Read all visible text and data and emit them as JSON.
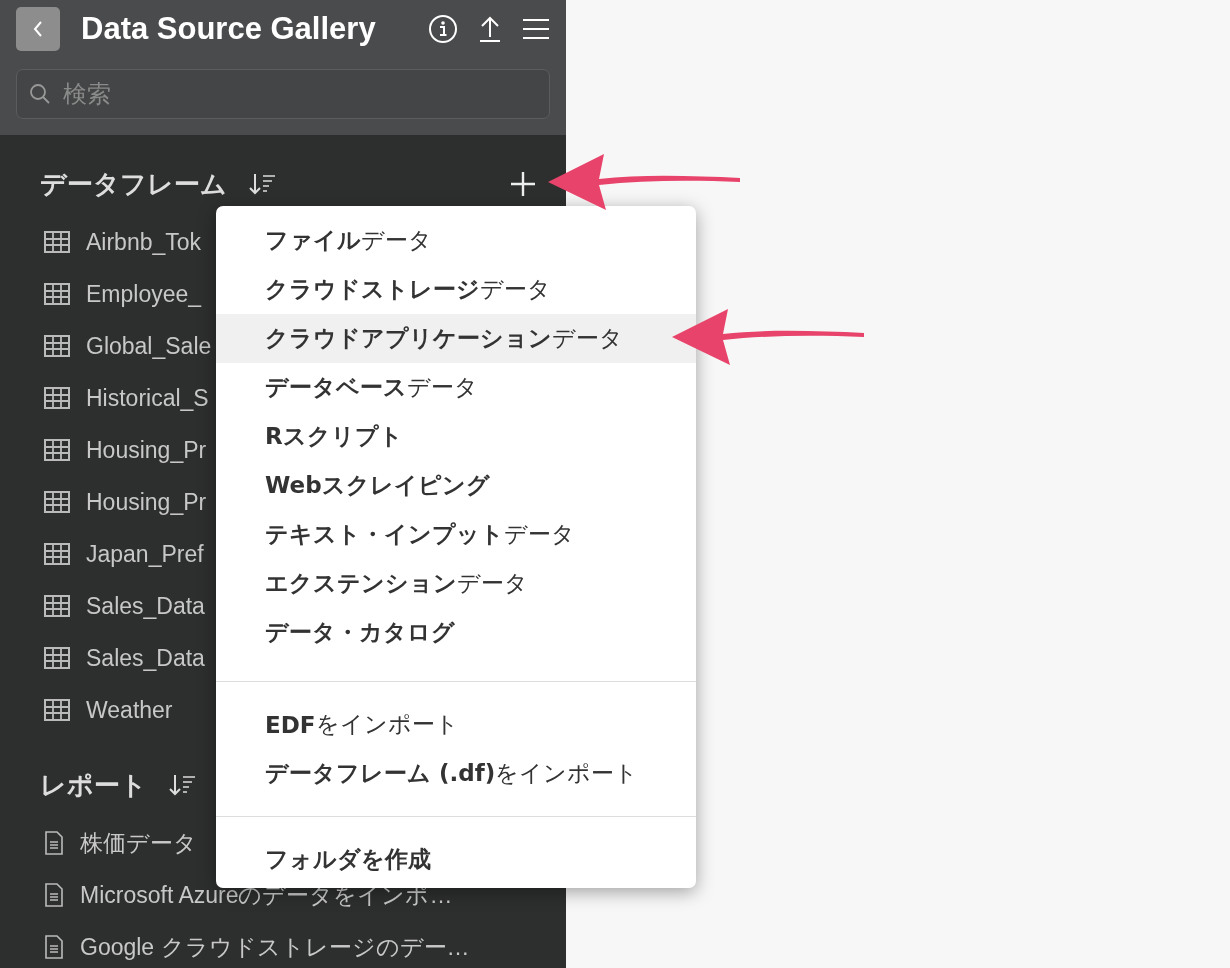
{
  "header": {
    "title": "Data Source Gallery"
  },
  "search": {
    "placeholder": "検索"
  },
  "dataframes": {
    "title": "データフレーム",
    "items": [
      {
        "label": "Airbnb_Tok"
      },
      {
        "label": "Employee_"
      },
      {
        "label": "Global_Sale"
      },
      {
        "label": "Historical_S"
      },
      {
        "label": "Housing_Pr"
      },
      {
        "label": "Housing_Pr"
      },
      {
        "label": "Japan_Pref"
      },
      {
        "label": "Sales_Data"
      },
      {
        "label": "Sales_Data"
      },
      {
        "label": "Weather"
      }
    ]
  },
  "reports": {
    "title": "レポート",
    "items": [
      {
        "label": "株価データ"
      },
      {
        "label": "Microsoft Azureのデータをインポ…"
      },
      {
        "label": "Google クラウドストレージのデー…"
      }
    ]
  },
  "menu": {
    "groups": [
      [
        {
          "label": "**ファイル**データ",
          "bold": false,
          "selected": false
        },
        {
          "label": "**クラウドストレージ**データ",
          "bold": false,
          "selected": false
        },
        {
          "label": "**クラウドアプリケーション**データ",
          "bold": false,
          "selected": true
        },
        {
          "label": "**データベース**データ",
          "bold": false,
          "selected": false
        },
        {
          "label": "Rスクリプト",
          "bold": true,
          "selected": false
        },
        {
          "label": "Webスクレイピング",
          "bold": true,
          "selected": false
        },
        {
          "label": "**テキスト・インプット**データ",
          "bold": false,
          "selected": false
        },
        {
          "label": "**エクステンション**データ",
          "bold": false,
          "selected": false
        },
        {
          "label": "データ・カタログ",
          "bold": true,
          "selected": false
        }
      ],
      [
        {
          "label": "**EDF**をインポート",
          "bold": false,
          "selected": false
        },
        {
          "label": "**データフレーム (.df)**をインポート",
          "bold": false,
          "selected": false
        }
      ],
      [
        {
          "label": "フォルダを作成",
          "bold": true,
          "selected": false
        }
      ]
    ]
  },
  "callouts": [
    {
      "kind": "arrow"
    },
    {
      "kind": "arrow"
    }
  ]
}
